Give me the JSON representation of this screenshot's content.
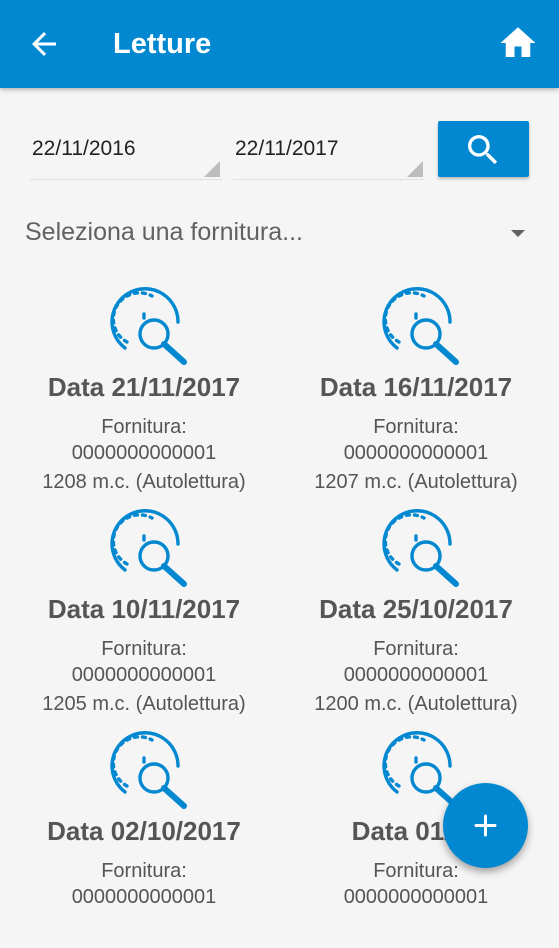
{
  "appbar": {
    "title": "Letture",
    "back_icon": "arrow-left-icon",
    "home_icon": "home-icon",
    "color": "#0288d1"
  },
  "filters": {
    "date_from": "22/11/2016",
    "date_to": "22/11/2017",
    "search_icon": "search-icon"
  },
  "supply_select": {
    "placeholder": "Seleziona una fornitura..."
  },
  "readings": [
    {
      "title": "Data 21/11/2017",
      "supply_label": "Fornitura:",
      "supply_number": "0000000000001",
      "value": "1208 m.c. (Autolettura)"
    },
    {
      "title": "Data 16/11/2017",
      "supply_label": "Fornitura:",
      "supply_number": "0000000000001",
      "value": "1207 m.c. (Autolettura)"
    },
    {
      "title": "Data 10/11/2017",
      "supply_label": "Fornitura:",
      "supply_number": "0000000000001",
      "value": "1205 m.c. (Autolettura)"
    },
    {
      "title": "Data 25/10/2017",
      "supply_label": "Fornitura:",
      "supply_number": "0000000000001",
      "value": "1200 m.c. (Autolettura)"
    },
    {
      "title": "Data 02/10/2017",
      "supply_label": "Fornitura:",
      "supply_number": "0000000000001",
      "value": ""
    },
    {
      "title": "Data 01/10",
      "supply_label": "Fornitura:",
      "supply_number": "0000000000001",
      "value": ""
    }
  ],
  "fab": {
    "icon": "plus-icon"
  }
}
